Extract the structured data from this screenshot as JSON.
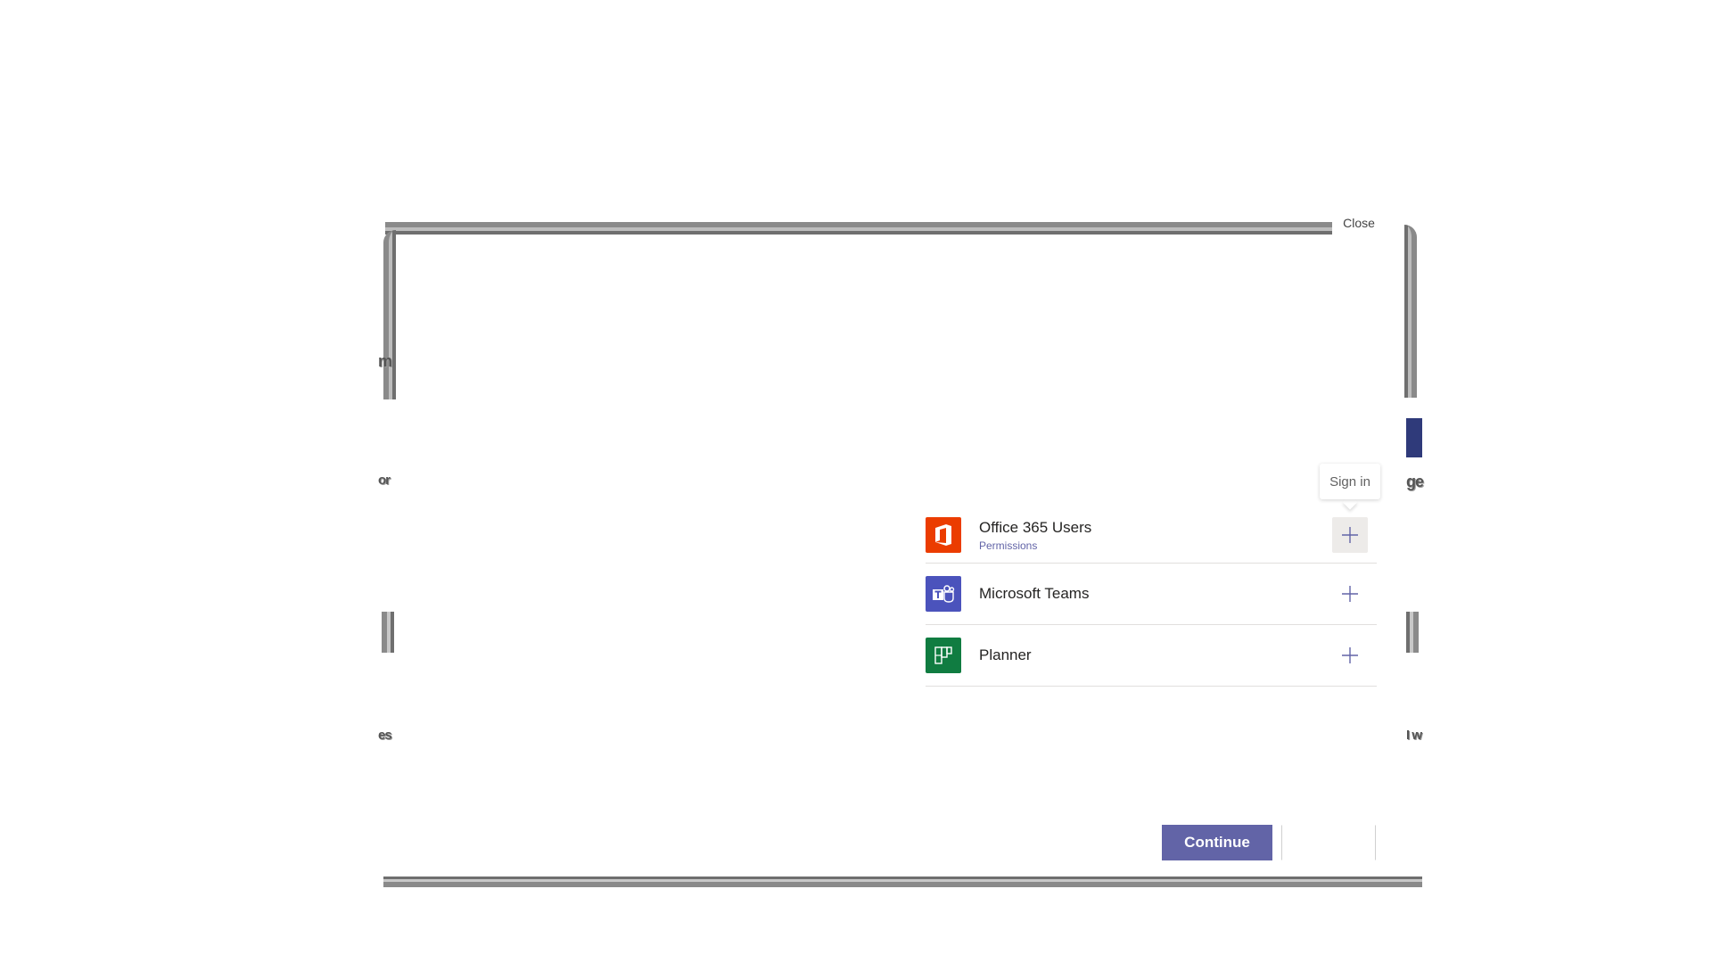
{
  "close_label": "Close",
  "tooltip": {
    "text": "Sign in"
  },
  "connectors": [
    {
      "name": "Office 365 Users",
      "sub": "Permissions",
      "icon": "office-icon",
      "color": "#eb3c00"
    },
    {
      "name": "Microsoft Teams",
      "sub": "",
      "icon": "teams-icon",
      "color": "#4b53bc"
    },
    {
      "name": "Planner",
      "sub": "",
      "icon": "planner-icon",
      "color": "#107c41"
    }
  ],
  "footer": {
    "continue_label": "Continue"
  },
  "ghost_text": {
    "left_1": "m",
    "left_2": "or",
    "left_3": "es",
    "right_1": "ge",
    "right_2": "I w"
  },
  "colors": {
    "accent": "#6264a7"
  }
}
